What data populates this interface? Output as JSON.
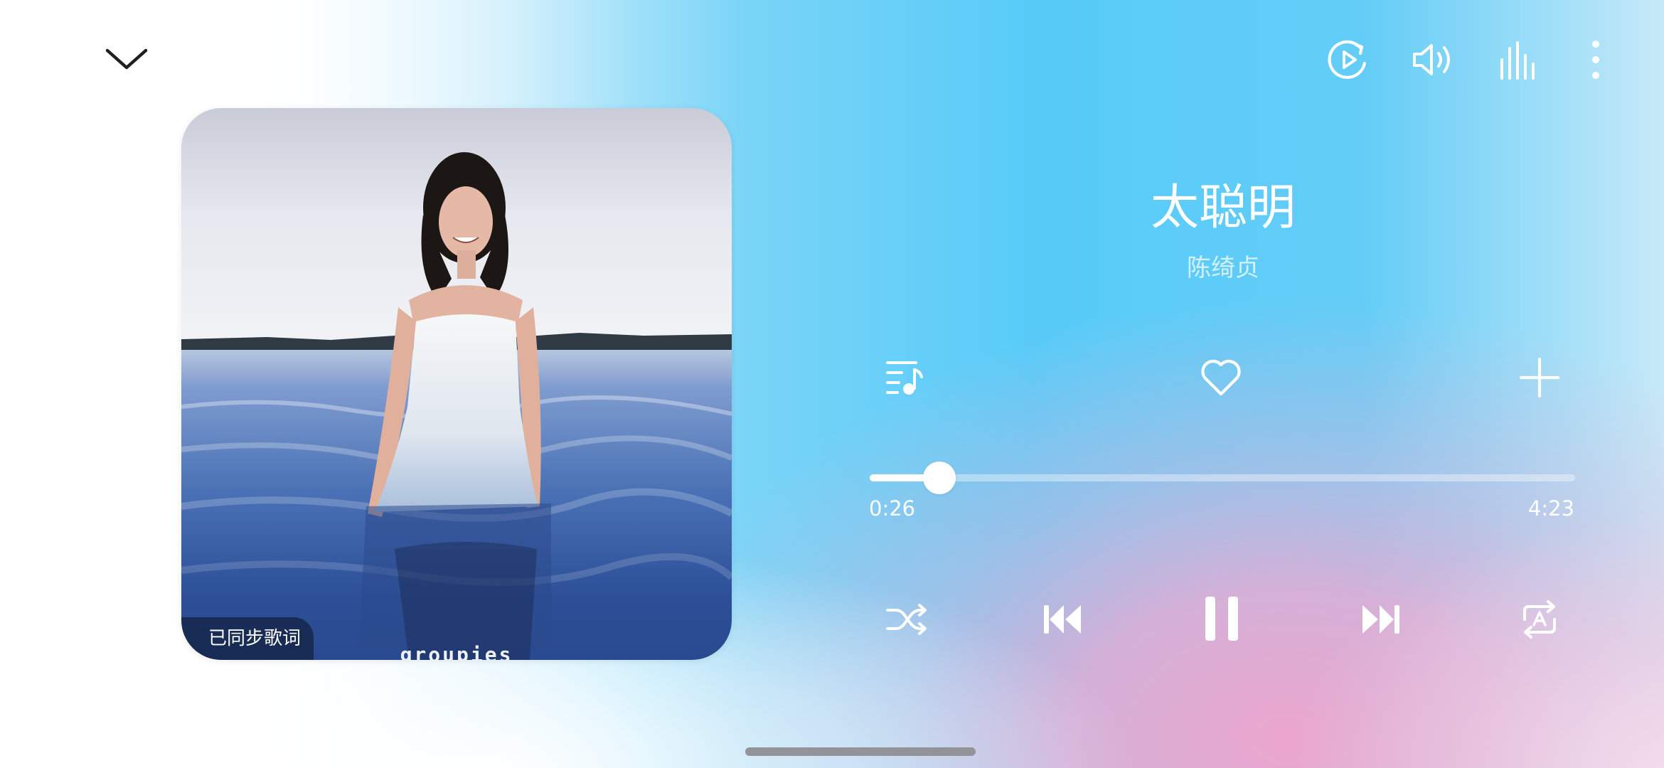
{
  "song": {
    "title": "太聪明",
    "artist": "陈绮贞"
  },
  "album": {
    "logo_text": "groupies",
    "lyrics_badge": "已同步歌词"
  },
  "playback": {
    "elapsed": "0:26",
    "total": "4:23",
    "progress_fraction": 0.099
  },
  "top_bar": {
    "icons": [
      "collapse-chevron-icon",
      "video-play-icon",
      "volume-icon",
      "equalizer-icon",
      "more-vertical-icon"
    ]
  },
  "actions": {
    "icons": [
      "playlist-icon",
      "heart-icon",
      "add-icon"
    ]
  },
  "controls": {
    "icons": [
      "shuffle-icon",
      "previous-icon",
      "pause-icon",
      "next-icon",
      "repeat-ab-icon"
    ]
  },
  "colors": {
    "icon": "#ffffff",
    "chevron": "#1f1f1f",
    "progress_fill": "#ffffff",
    "progress_track": "rgba(255,255,255,0.38)"
  }
}
